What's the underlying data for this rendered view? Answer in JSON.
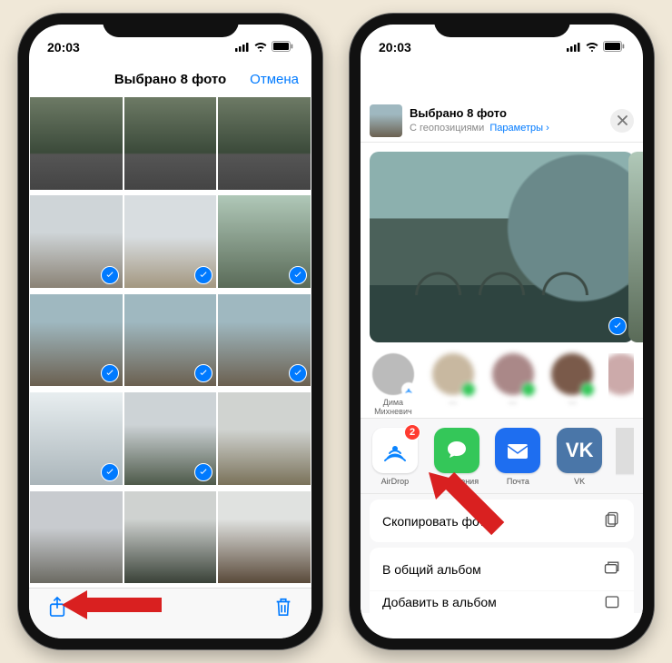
{
  "statusbar": {
    "time": "20:03"
  },
  "left": {
    "title": "Выбрано 8 фото",
    "cancel": "Отмена"
  },
  "right": {
    "title": "Выбрано 8 фото",
    "subtitle": "С геопозициями",
    "options": "Параметры",
    "contact_name": "Дима Михневич",
    "airdrop_badge": "2",
    "apps": {
      "airdrop": "AirDrop",
      "messages": "Сообщения",
      "mail": "Почта",
      "vk": "VK"
    },
    "actions": {
      "copy": "Скопировать фото",
      "shared_album": "В общий альбом",
      "add_album": "Добавить в альбом"
    }
  }
}
